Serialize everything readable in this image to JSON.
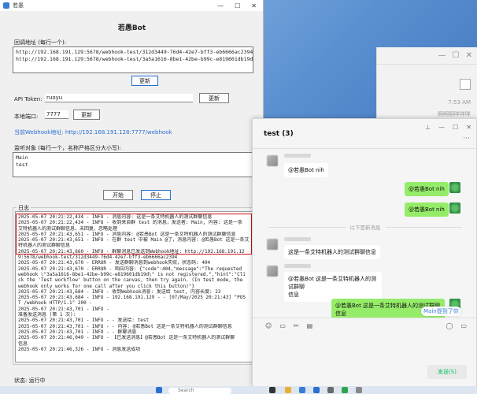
{
  "app": {
    "window_title": "若愚",
    "title": "若愚Bot",
    "callback_label": "回调地址 (每行一个):",
    "callback_urls": "http://192.168.191.129:5678/webhook-test/312d3449-76d4-42e7-bff3-eb6666ac2394\nhttp://192.168.191.129:5678/webhook-test/3a5a1616-8be1-42be-b99c-e819601db19d",
    "update_label": "更新",
    "api_token_label": "API Token:",
    "api_token_value": "ruoyu",
    "port_label": "本地端口:",
    "port_value": "7777",
    "webhook_text": "当前Webhook地址: http://192.168.191.128:7777/webhook",
    "monitor_label": "监听对象 (每行一个，名称严格区分大小写):",
    "monitor_objects": "Main\ntest",
    "start_label": "开始",
    "stop_label": "停止",
    "log_label": "日志",
    "log_lines": [
      "2025-05-07 20:21:22,434 - INFO - 消息内容: 这是一条艾特机器人的测试群聊信息",
      "2025-05-07 20:21:22,434 - INFO - 收到来自群 test 的消息，发送者: Main, 内容: 这是一条",
      "艾特机器人的测试群聊信息，未回复，忽略处理",
      "2025-05-07 20:21:43,651 - INFO - 消息内容: @若愚Bot 这是一条艾特机器人的测试群聊信息",
      "2025-05-07 20:21:43,651 - INFO - 在群 test 中被 Main @了，消息内容: @若愚Bot 这是一条艾",
      "特机器人的测试群聊信息",
      "2025-05-07 20:21:43,660 - INFO - 群聊消息已发送到Webhook地址: http://192.168.191.12",
      "9:5678/webhook-test/312d3449-76d4-42e7-bff3-eb6666ac2394",
      "2025-05-07 20:21:43,670 - ERROR - 发送群聊消息到webhook失败，状态码: 404",
      "2025-05-07 20:21:43,670 - ERROR - 响应内容: {\"code\":404,\"message\":\"The requested",
      " webhook \\\"3a5a1616-8be1-42be-b99c-e819601db19d\\\" is not registered.\",\"hint\":\"Cli",
      "ck the 'Test workflow' button on the canvas, then try again. (In test mode, the",
      " webhook only works for one call after you click this button)\"}",
      "2025-05-07 20:21:43,684 - INFO - 收到Webhook消息: 发送给 test, 内容长度: 23",
      "2025-05-07 20:21:43,684 - INFO - 192.168.191.129 - - [07/May/2025 20:21:43] \"POS",
      "T /webhook HTTP/1.1\" 200 -",
      "2025-05-07 20:21:43,701 - INFO -",
      "准备发送消息 (第 1 次):",
      "2025-05-07 20:21:43,701 - INFO - - 发送给: test",
      "2025-05-07 20:21:43,701 - INFO - - 内容: @若愚Bot 这是一条艾特机器人的测试群聊信息",
      "2025-05-07 20:21:43,701 - INFO - - 群聊消息",
      "2025-05-07 20:21:46,049 - INFO - 【已发送消息】@若愚Bot 这是一条艾特机器人的测试群聊",
      "信息",
      "2025-05-07 20:21:46,326 - INFO - 消息发送成功"
    ],
    "status_text": "状态: 运行中"
  },
  "bgapp": {
    "time": "7:53 AM",
    "snippet": "啊啊啊咩咩咩"
  },
  "chat": {
    "title": "test (3)",
    "messages": [
      {
        "side": "left",
        "text": "@若愚Bot nih"
      },
      {
        "side": "right",
        "text": "@若愚Bot nih"
      },
      {
        "side": "right",
        "text": "@若愚Bot nih"
      },
      {
        "side": "left",
        "text": "这是一条艾特机器人的测试群聊信息"
      },
      {
        "side": "left",
        "text": "@若愚Bot 这是一条艾特机器人的测试群聊\n信息"
      },
      {
        "side": "right",
        "text": "@若愚Bot 这是一条艾特机器人的测试群聊\n信息"
      }
    ],
    "divider": "以下是新消息",
    "mention_tip": "Main提到了你",
    "send_label": "发送(S)"
  },
  "taskbar": {
    "search_placeholder": "Search"
  },
  "colors": {
    "accent": "#2a6fd0",
    "highlight": "#d01010",
    "chat_bubble_self": "#95ec69",
    "send_text": "#07c160"
  }
}
